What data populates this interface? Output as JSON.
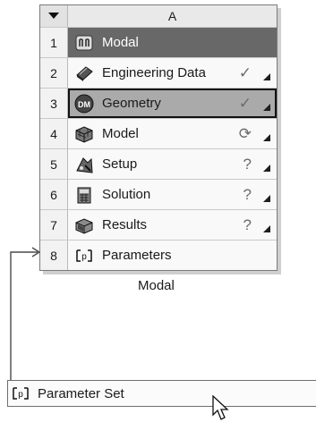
{
  "system": {
    "column_header": "A",
    "sort_glyph": "triangle-down-icon",
    "rows": [
      {
        "num": "1",
        "label": "Modal",
        "icon": "modal-analysis-icon",
        "status": "",
        "status_icon": ""
      },
      {
        "num": "2",
        "label": "Engineering Data",
        "icon": "engineering-data-icon",
        "status": "✓",
        "status_icon": "check-icon"
      },
      {
        "num": "3",
        "label": "Geometry",
        "icon": "geometry-dm-icon",
        "status": "✓",
        "status_icon": "check-icon"
      },
      {
        "num": "4",
        "label": "Model",
        "icon": "model-icon",
        "status": "⟳",
        "status_icon": "refresh-icon"
      },
      {
        "num": "5",
        "label": "Setup",
        "icon": "setup-icon",
        "status": "?",
        "status_icon": "unfulfilled-icon"
      },
      {
        "num": "6",
        "label": "Solution",
        "icon": "solution-icon",
        "status": "?",
        "status_icon": "unfulfilled-icon"
      },
      {
        "num": "7",
        "label": "Results",
        "icon": "results-icon",
        "status": "?",
        "status_icon": "unfulfilled-icon"
      },
      {
        "num": "8",
        "label": "Parameters",
        "icon": "parameters-icon",
        "status": "",
        "status_icon": ""
      }
    ],
    "caption": "Modal"
  },
  "parameter_set": {
    "label": "Parameter Set",
    "icon": "parameter-set-icon"
  },
  "cursor": "mouse-pointer-icon",
  "colors": {
    "title_row": "#686868",
    "selected_row": "#aaaaaa",
    "border": "#7a7a7a"
  }
}
